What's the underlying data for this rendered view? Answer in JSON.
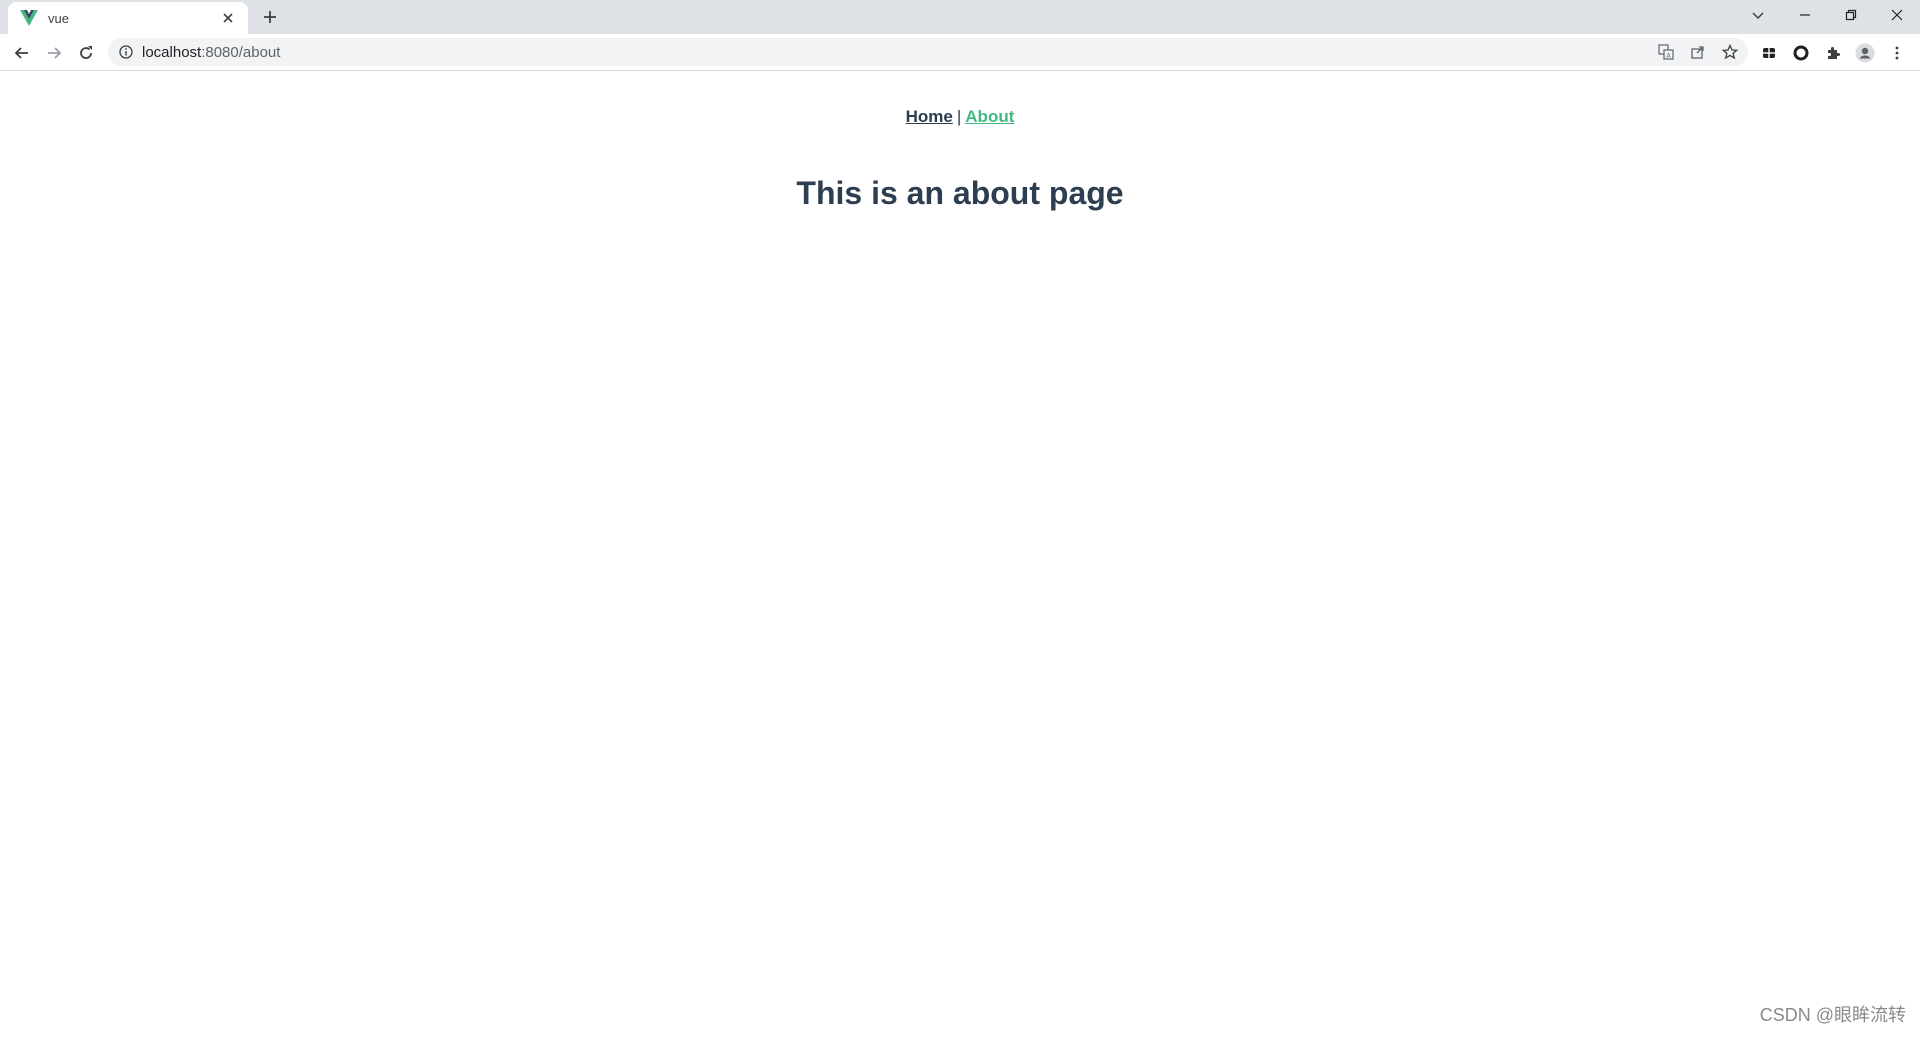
{
  "tab": {
    "title": "vue",
    "favicon": "vue-logo-icon"
  },
  "address_bar": {
    "host": "localhost",
    "path": ":8080/about"
  },
  "page": {
    "nav": {
      "home_label": "Home",
      "separator": "|",
      "about_label": "About"
    },
    "heading": "This is an about page"
  },
  "watermark": "CSDN @眼眸流转",
  "colors": {
    "accent": "#42b983",
    "text": "#2c3e50",
    "tabstrip": "#dee1e6",
    "omnibox": "#f1f3f4"
  }
}
